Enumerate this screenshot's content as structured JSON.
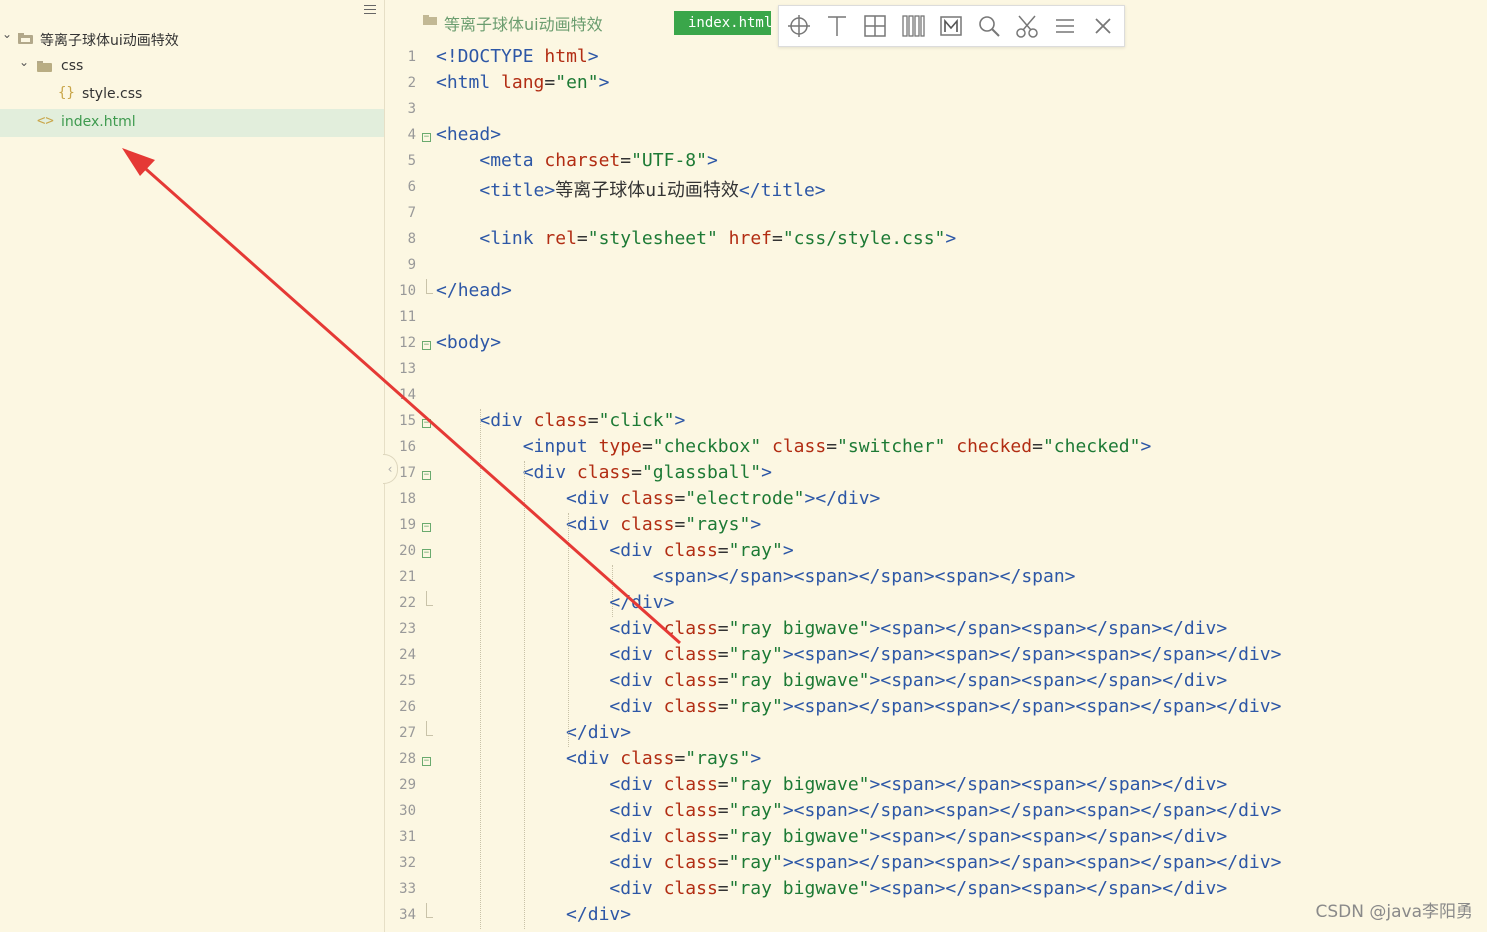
{
  "sidebar": {
    "project": "等离子球体ui动画特效",
    "items": [
      {
        "label": "css",
        "type": "folder"
      },
      {
        "label": "style.css",
        "type": "file-css",
        "icon": "{}"
      },
      {
        "label": "index.html",
        "type": "file-html",
        "icon": "<>",
        "selected": true
      }
    ]
  },
  "editor": {
    "breadcrumb": "等离子球体ui动画特效",
    "active_tab": "index.html",
    "toolbar": [
      "crosshair-icon",
      "text-icon",
      "grid-icon",
      "columns-icon",
      "marker-icon",
      "search-icon",
      "scissors-icon",
      "menu-icon",
      "close-icon"
    ]
  },
  "code_lines": [
    {
      "n": "1",
      "tokens": [
        [
          "br",
          "<"
        ],
        [
          "dt",
          "!DOCTYPE "
        ],
        [
          "attr",
          "html"
        ],
        [
          "br",
          ">"
        ]
      ]
    },
    {
      "n": "2",
      "tokens": [
        [
          "br",
          "<"
        ],
        [
          "tag",
          "html "
        ],
        [
          "attr",
          "lang"
        ],
        [
          "eq",
          "="
        ],
        [
          "val",
          "\"en\""
        ],
        [
          "br",
          ">"
        ]
      ]
    },
    {
      "n": "3",
      "tokens": []
    },
    {
      "n": "4",
      "fold": true,
      "tokens": [
        [
          "br",
          "<"
        ],
        [
          "tag",
          "head"
        ],
        [
          "br",
          ">"
        ]
      ]
    },
    {
      "n": "5",
      "tokens": [
        [
          "txt",
          "    "
        ],
        [
          "br",
          "<"
        ],
        [
          "tag",
          "meta "
        ],
        [
          "attr",
          "charset"
        ],
        [
          "eq",
          "="
        ],
        [
          "val",
          "\"UTF-8\""
        ],
        [
          "br",
          ">"
        ]
      ]
    },
    {
      "n": "6",
      "tokens": [
        [
          "txt",
          "    "
        ],
        [
          "br",
          "<"
        ],
        [
          "tag",
          "title"
        ],
        [
          "br",
          ">"
        ],
        [
          "txt",
          "等离子球体ui动画特效"
        ],
        [
          "br",
          "</"
        ],
        [
          "tag",
          "title"
        ],
        [
          "br",
          ">"
        ]
      ]
    },
    {
      "n": "7",
      "tokens": []
    },
    {
      "n": "8",
      "tokens": [
        [
          "txt",
          "    "
        ],
        [
          "br",
          "<"
        ],
        [
          "tag",
          "link "
        ],
        [
          "attr",
          "rel"
        ],
        [
          "eq",
          "="
        ],
        [
          "val",
          "\"stylesheet\" "
        ],
        [
          "attr",
          "href"
        ],
        [
          "eq",
          "="
        ],
        [
          "val",
          "\"css/style.css\""
        ],
        [
          "br",
          ">"
        ]
      ]
    },
    {
      "n": "9",
      "tokens": []
    },
    {
      "n": "10",
      "foldend": true,
      "tokens": [
        [
          "br",
          "</"
        ],
        [
          "tag",
          "head"
        ],
        [
          "br",
          ">"
        ]
      ]
    },
    {
      "n": "11",
      "tokens": []
    },
    {
      "n": "12",
      "fold": true,
      "tokens": [
        [
          "br",
          "<"
        ],
        [
          "tag",
          "body"
        ],
        [
          "br",
          ">"
        ]
      ]
    },
    {
      "n": "13",
      "tokens": []
    },
    {
      "n": "14",
      "tokens": []
    },
    {
      "n": "15",
      "fold": true,
      "tokens": [
        [
          "txt",
          "    "
        ],
        [
          "br",
          "<"
        ],
        [
          "tag",
          "div "
        ],
        [
          "attr",
          "class"
        ],
        [
          "eq",
          "="
        ],
        [
          "val",
          "\"click\""
        ],
        [
          "br",
          ">"
        ]
      ]
    },
    {
      "n": "16",
      "tokens": [
        [
          "txt",
          "        "
        ],
        [
          "br",
          "<"
        ],
        [
          "tag",
          "input "
        ],
        [
          "attr",
          "type"
        ],
        [
          "eq",
          "="
        ],
        [
          "val",
          "\"checkbox\" "
        ],
        [
          "attr",
          "class"
        ],
        [
          "eq",
          "="
        ],
        [
          "val",
          "\"switcher\" "
        ],
        [
          "attr",
          "checked"
        ],
        [
          "eq",
          "="
        ],
        [
          "val",
          "\"checked\""
        ],
        [
          "br",
          ">"
        ]
      ]
    },
    {
      "n": "17",
      "fold": true,
      "tokens": [
        [
          "txt",
          "        "
        ],
        [
          "br",
          "<"
        ],
        [
          "tag",
          "div "
        ],
        [
          "attr",
          "class"
        ],
        [
          "eq",
          "="
        ],
        [
          "val",
          "\"glassball\""
        ],
        [
          "br",
          ">"
        ]
      ]
    },
    {
      "n": "18",
      "tokens": [
        [
          "txt",
          "            "
        ],
        [
          "br",
          "<"
        ],
        [
          "tag",
          "div "
        ],
        [
          "attr",
          "class"
        ],
        [
          "eq",
          "="
        ],
        [
          "val",
          "\"electrode\""
        ],
        [
          "br",
          "></"
        ],
        [
          "tag",
          "div"
        ],
        [
          "br",
          ">"
        ]
      ]
    },
    {
      "n": "19",
      "fold": true,
      "tokens": [
        [
          "txt",
          "            "
        ],
        [
          "br",
          "<"
        ],
        [
          "tag",
          "div "
        ],
        [
          "attr",
          "class"
        ],
        [
          "eq",
          "="
        ],
        [
          "val",
          "\"rays\""
        ],
        [
          "br",
          ">"
        ]
      ]
    },
    {
      "n": "20",
      "fold": true,
      "tokens": [
        [
          "txt",
          "                "
        ],
        [
          "br",
          "<"
        ],
        [
          "tag",
          "div "
        ],
        [
          "attr",
          "class"
        ],
        [
          "eq",
          "="
        ],
        [
          "val",
          "\"ray\""
        ],
        [
          "br",
          ">"
        ]
      ]
    },
    {
      "n": "21",
      "tokens": [
        [
          "txt",
          "                    "
        ],
        [
          "br",
          "<"
        ],
        [
          "tag",
          "span"
        ],
        [
          "br",
          "></"
        ],
        [
          "tag",
          "span"
        ],
        [
          "br",
          "><"
        ],
        [
          "tag",
          "span"
        ],
        [
          "br",
          "></"
        ],
        [
          "tag",
          "span"
        ],
        [
          "br",
          "><"
        ],
        [
          "tag",
          "span"
        ],
        [
          "br",
          "></"
        ],
        [
          "tag",
          "span"
        ],
        [
          "br",
          ">"
        ]
      ]
    },
    {
      "n": "22",
      "foldend": true,
      "tokens": [
        [
          "txt",
          "                "
        ],
        [
          "br",
          "</"
        ],
        [
          "tag",
          "div"
        ],
        [
          "br",
          ">"
        ]
      ]
    },
    {
      "n": "23",
      "tokens": [
        [
          "txt",
          "                "
        ],
        [
          "br",
          "<"
        ],
        [
          "tag",
          "div "
        ],
        [
          "attr",
          "class"
        ],
        [
          "eq",
          "="
        ],
        [
          "val",
          "\"ray bigwave\""
        ],
        [
          "br",
          "><"
        ],
        [
          "tag",
          "span"
        ],
        [
          "br",
          "></"
        ],
        [
          "tag",
          "span"
        ],
        [
          "br",
          "><"
        ],
        [
          "tag",
          "span"
        ],
        [
          "br",
          "></"
        ],
        [
          "tag",
          "span"
        ],
        [
          "br",
          "></"
        ],
        [
          "tag",
          "div"
        ],
        [
          "br",
          ">"
        ]
      ]
    },
    {
      "n": "24",
      "tokens": [
        [
          "txt",
          "                "
        ],
        [
          "br",
          "<"
        ],
        [
          "tag",
          "div "
        ],
        [
          "attr",
          "class"
        ],
        [
          "eq",
          "="
        ],
        [
          "val",
          "\"ray\""
        ],
        [
          "br",
          "><"
        ],
        [
          "tag",
          "span"
        ],
        [
          "br",
          "></"
        ],
        [
          "tag",
          "span"
        ],
        [
          "br",
          "><"
        ],
        [
          "tag",
          "span"
        ],
        [
          "br",
          "></"
        ],
        [
          "tag",
          "span"
        ],
        [
          "br",
          "><"
        ],
        [
          "tag",
          "span"
        ],
        [
          "br",
          "></"
        ],
        [
          "tag",
          "span"
        ],
        [
          "br",
          "></"
        ],
        [
          "tag",
          "div"
        ],
        [
          "br",
          ">"
        ]
      ]
    },
    {
      "n": "25",
      "tokens": [
        [
          "txt",
          "                "
        ],
        [
          "br",
          "<"
        ],
        [
          "tag",
          "div "
        ],
        [
          "attr",
          "class"
        ],
        [
          "eq",
          "="
        ],
        [
          "val",
          "\"ray bigwave\""
        ],
        [
          "br",
          "><"
        ],
        [
          "tag",
          "span"
        ],
        [
          "br",
          "></"
        ],
        [
          "tag",
          "span"
        ],
        [
          "br",
          "><"
        ],
        [
          "tag",
          "span"
        ],
        [
          "br",
          "></"
        ],
        [
          "tag",
          "span"
        ],
        [
          "br",
          "></"
        ],
        [
          "tag",
          "div"
        ],
        [
          "br",
          ">"
        ]
      ]
    },
    {
      "n": "26",
      "tokens": [
        [
          "txt",
          "                "
        ],
        [
          "br",
          "<"
        ],
        [
          "tag",
          "div "
        ],
        [
          "attr",
          "class"
        ],
        [
          "eq",
          "="
        ],
        [
          "val",
          "\"ray\""
        ],
        [
          "br",
          "><"
        ],
        [
          "tag",
          "span"
        ],
        [
          "br",
          "></"
        ],
        [
          "tag",
          "span"
        ],
        [
          "br",
          "><"
        ],
        [
          "tag",
          "span"
        ],
        [
          "br",
          "></"
        ],
        [
          "tag",
          "span"
        ],
        [
          "br",
          "><"
        ],
        [
          "tag",
          "span"
        ],
        [
          "br",
          "></"
        ],
        [
          "tag",
          "span"
        ],
        [
          "br",
          "></"
        ],
        [
          "tag",
          "div"
        ],
        [
          "br",
          ">"
        ]
      ]
    },
    {
      "n": "27",
      "foldend": true,
      "tokens": [
        [
          "txt",
          "            "
        ],
        [
          "br",
          "</"
        ],
        [
          "tag",
          "div"
        ],
        [
          "br",
          ">"
        ]
      ]
    },
    {
      "n": "28",
      "fold": true,
      "tokens": [
        [
          "txt",
          "            "
        ],
        [
          "br",
          "<"
        ],
        [
          "tag",
          "div "
        ],
        [
          "attr",
          "class"
        ],
        [
          "eq",
          "="
        ],
        [
          "val",
          "\"rays\""
        ],
        [
          "br",
          ">"
        ]
      ]
    },
    {
      "n": "29",
      "tokens": [
        [
          "txt",
          "                "
        ],
        [
          "br",
          "<"
        ],
        [
          "tag",
          "div "
        ],
        [
          "attr",
          "class"
        ],
        [
          "eq",
          "="
        ],
        [
          "val",
          "\"ray bigwave\""
        ],
        [
          "br",
          "><"
        ],
        [
          "tag",
          "span"
        ],
        [
          "br",
          "></"
        ],
        [
          "tag",
          "span"
        ],
        [
          "br",
          "><"
        ],
        [
          "tag",
          "span"
        ],
        [
          "br",
          "></"
        ],
        [
          "tag",
          "span"
        ],
        [
          "br",
          "></"
        ],
        [
          "tag",
          "div"
        ],
        [
          "br",
          ">"
        ]
      ]
    },
    {
      "n": "30",
      "tokens": [
        [
          "txt",
          "                "
        ],
        [
          "br",
          "<"
        ],
        [
          "tag",
          "div "
        ],
        [
          "attr",
          "class"
        ],
        [
          "eq",
          "="
        ],
        [
          "val",
          "\"ray\""
        ],
        [
          "br",
          "><"
        ],
        [
          "tag",
          "span"
        ],
        [
          "br",
          "></"
        ],
        [
          "tag",
          "span"
        ],
        [
          "br",
          "><"
        ],
        [
          "tag",
          "span"
        ],
        [
          "br",
          "></"
        ],
        [
          "tag",
          "span"
        ],
        [
          "br",
          "><"
        ],
        [
          "tag",
          "span"
        ],
        [
          "br",
          "></"
        ],
        [
          "tag",
          "span"
        ],
        [
          "br",
          "></"
        ],
        [
          "tag",
          "div"
        ],
        [
          "br",
          ">"
        ]
      ]
    },
    {
      "n": "31",
      "tokens": [
        [
          "txt",
          "                "
        ],
        [
          "br",
          "<"
        ],
        [
          "tag",
          "div "
        ],
        [
          "attr",
          "class"
        ],
        [
          "eq",
          "="
        ],
        [
          "val",
          "\"ray bigwave\""
        ],
        [
          "br",
          "><"
        ],
        [
          "tag",
          "span"
        ],
        [
          "br",
          "></"
        ],
        [
          "tag",
          "span"
        ],
        [
          "br",
          "><"
        ],
        [
          "tag",
          "span"
        ],
        [
          "br",
          "></"
        ],
        [
          "tag",
          "span"
        ],
        [
          "br",
          "></"
        ],
        [
          "tag",
          "div"
        ],
        [
          "br",
          ">"
        ]
      ]
    },
    {
      "n": "32",
      "tokens": [
        [
          "txt",
          "                "
        ],
        [
          "br",
          "<"
        ],
        [
          "tag",
          "div "
        ],
        [
          "attr",
          "class"
        ],
        [
          "eq",
          "="
        ],
        [
          "val",
          "\"ray\""
        ],
        [
          "br",
          "><"
        ],
        [
          "tag",
          "span"
        ],
        [
          "br",
          "></"
        ],
        [
          "tag",
          "span"
        ],
        [
          "br",
          "><"
        ],
        [
          "tag",
          "span"
        ],
        [
          "br",
          "></"
        ],
        [
          "tag",
          "span"
        ],
        [
          "br",
          "><"
        ],
        [
          "tag",
          "span"
        ],
        [
          "br",
          "></"
        ],
        [
          "tag",
          "span"
        ],
        [
          "br",
          "></"
        ],
        [
          "tag",
          "div"
        ],
        [
          "br",
          ">"
        ]
      ]
    },
    {
      "n": "33",
      "tokens": [
        [
          "txt",
          "                "
        ],
        [
          "br",
          "<"
        ],
        [
          "tag",
          "div "
        ],
        [
          "attr",
          "class"
        ],
        [
          "eq",
          "="
        ],
        [
          "val",
          "\"ray bigwave\""
        ],
        [
          "br",
          "><"
        ],
        [
          "tag",
          "span"
        ],
        [
          "br",
          "></"
        ],
        [
          "tag",
          "span"
        ],
        [
          "br",
          "><"
        ],
        [
          "tag",
          "span"
        ],
        [
          "br",
          "></"
        ],
        [
          "tag",
          "span"
        ],
        [
          "br",
          "></"
        ],
        [
          "tag",
          "div"
        ],
        [
          "br",
          ">"
        ]
      ]
    },
    {
      "n": "34",
      "foldend": true,
      "tokens": [
        [
          "txt",
          "            "
        ],
        [
          "br",
          "</"
        ],
        [
          "tag",
          "div"
        ],
        [
          "br",
          ">"
        ]
      ]
    }
  ],
  "annotation": {
    "color": "#e53935",
    "description_icon": "red-arrow"
  },
  "watermark": "CSDN @java李阳勇"
}
